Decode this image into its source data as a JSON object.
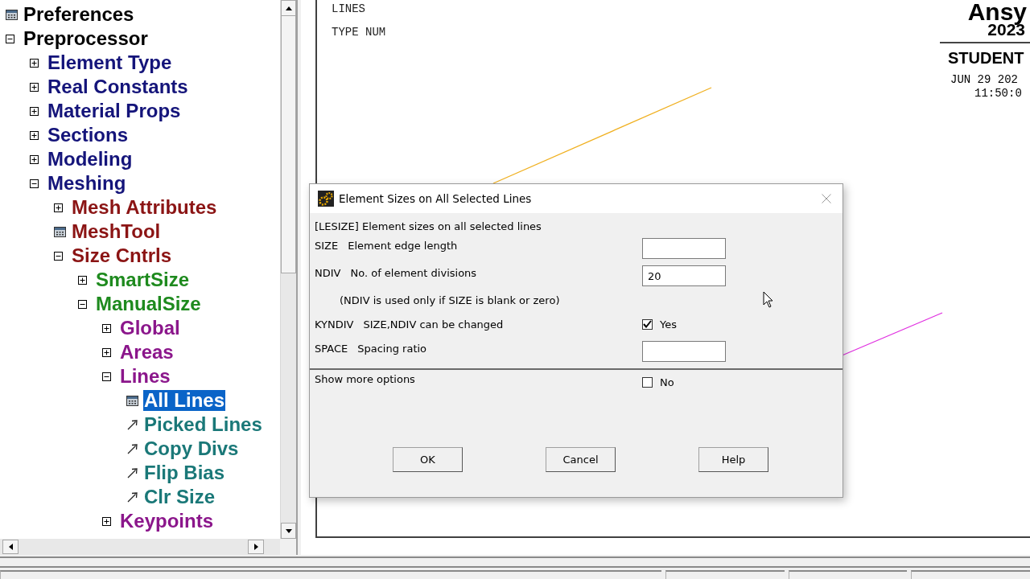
{
  "tree": [
    {
      "label": "Preferences",
      "kind": "dialog",
      "selected": false
    },
    {
      "label": "Preprocessor",
      "kind": "branch",
      "expanded": true,
      "selected": false,
      "children": [
        {
          "label": "Element Type",
          "kind": "branch",
          "expanded": false,
          "selected": false
        },
        {
          "label": "Real Constants",
          "kind": "branch",
          "expanded": false,
          "selected": false
        },
        {
          "label": "Material Props",
          "kind": "branch",
          "expanded": false,
          "selected": false
        },
        {
          "label": "Sections",
          "kind": "branch",
          "expanded": false,
          "selected": false
        },
        {
          "label": "Modeling",
          "kind": "branch",
          "expanded": false,
          "selected": false
        },
        {
          "label": "Meshing",
          "kind": "branch",
          "expanded": true,
          "selected": false,
          "children": [
            {
              "label": "Mesh Attributes",
              "kind": "branch",
              "expanded": false,
              "selected": false
            },
            {
              "label": "MeshTool",
              "kind": "dialog",
              "selected": false
            },
            {
              "label": "Size Cntrls",
              "kind": "branch",
              "expanded": true,
              "selected": false,
              "children": [
                {
                  "label": "SmartSize",
                  "kind": "branch",
                  "expanded": false,
                  "selected": false
                },
                {
                  "label": "ManualSize",
                  "kind": "branch",
                  "expanded": true,
                  "selected": false,
                  "children": [
                    {
                      "label": "Global",
                      "kind": "branch",
                      "expanded": false,
                      "selected": false
                    },
                    {
                      "label": "Areas",
                      "kind": "branch",
                      "expanded": false,
                      "selected": false
                    },
                    {
                      "label": "Lines",
                      "kind": "branch",
                      "expanded": true,
                      "selected": false,
                      "children": [
                        {
                          "label": "All Lines",
                          "kind": "dialog",
                          "selected": true
                        },
                        {
                          "label": "Picked Lines",
                          "kind": "pick",
                          "selected": false
                        },
                        {
                          "label": "Copy Divs",
                          "kind": "pick",
                          "selected": false
                        },
                        {
                          "label": "Flip Bias",
                          "kind": "pick",
                          "selected": false
                        },
                        {
                          "label": "Clr Size",
                          "kind": "pick",
                          "selected": false
                        }
                      ]
                    },
                    {
                      "label": "Keypoints",
                      "kind": "branch",
                      "expanded": false,
                      "selected": false
                    }
                  ]
                }
              ]
            }
          ]
        }
      ]
    }
  ],
  "graphics": {
    "labels": [
      "LINES",
      "TYPE NUM"
    ],
    "logo": {
      "brand": "Ansy",
      "year": "2023",
      "edition": "STUDENT",
      "date": "JUN 29 202",
      "time": "11:50:0"
    }
  },
  "dialog": {
    "title": "Element Sizes on All Selected Lines",
    "heading": "[LESIZE]  Element sizes on all selected lines",
    "rows": [
      {
        "kind": "input",
        "code": "SIZE",
        "label": "Element edge length"
      },
      {
        "kind": "input",
        "code": "NDIV",
        "label": "No. of element divisions",
        "value": "20"
      },
      {
        "kind": "note",
        "label": "(NDIV is used only if SIZE is blank or zero)"
      },
      {
        "kind": "checkbox",
        "code": "KYNDIV",
        "label": "SIZE,NDIV can be changed",
        "checked": true,
        "option": "Yes"
      },
      {
        "kind": "input",
        "code": "SPACE",
        "label": "Spacing ratio"
      }
    ],
    "more": {
      "label": "Show more options",
      "checked": false,
      "option": "No"
    },
    "buttons": [
      "OK",
      "Cancel",
      "Help"
    ]
  }
}
